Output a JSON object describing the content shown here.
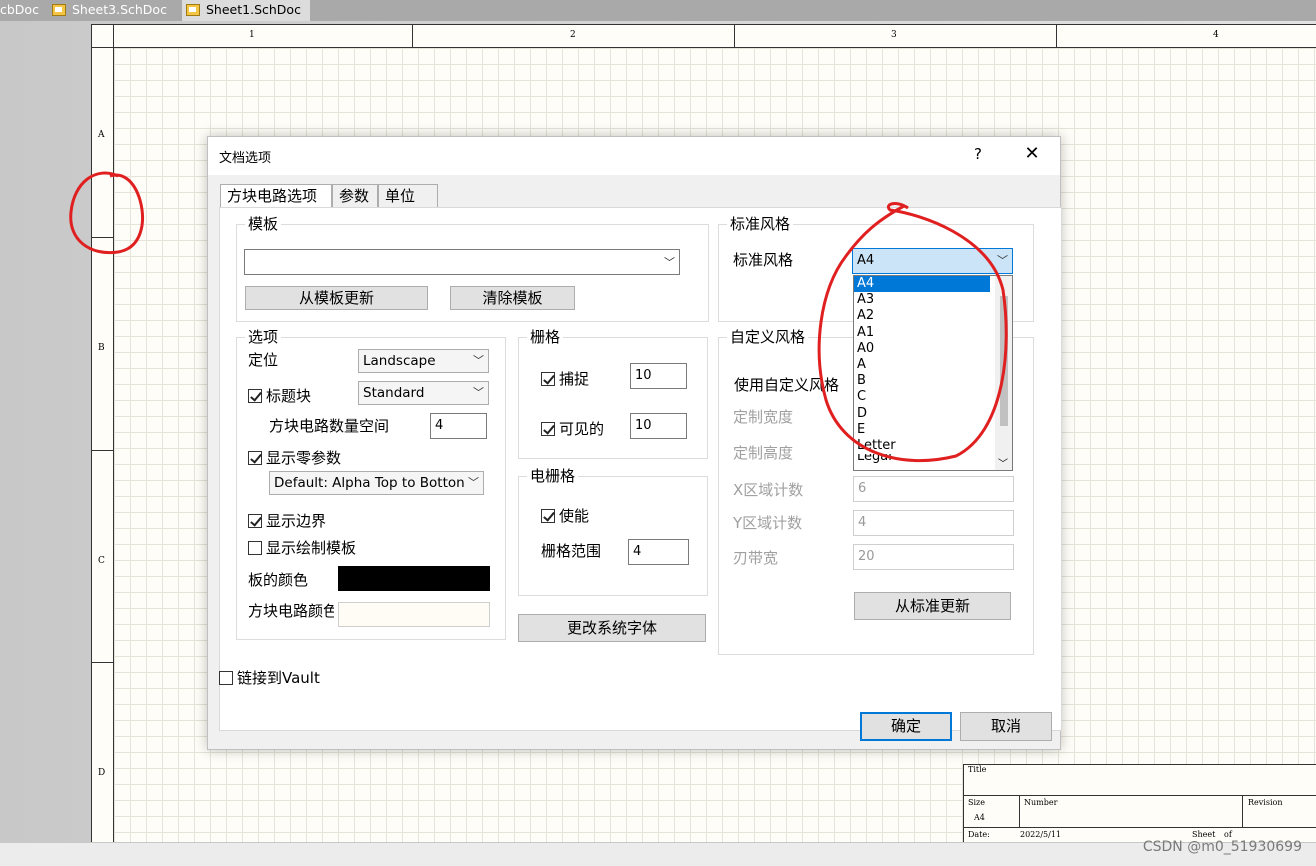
{
  "doc_tabs": [
    {
      "label": "cbDoc"
    },
    {
      "label": "Sheet3.SchDoc"
    },
    {
      "label": "Sheet1.SchDoc"
    }
  ],
  "sheet": {
    "col_labels": [
      "1",
      "2",
      "3",
      "4"
    ],
    "row_labels": [
      "A",
      "B",
      "C",
      "D"
    ],
    "title_block": {
      "title": "Title",
      "size": "Size",
      "size_value": "A4",
      "number": "Number",
      "revision": "Revision",
      "date": "Date:",
      "date_value": "2022/5/11",
      "sheet": "Sheet",
      "of": "of"
    }
  },
  "dialog": {
    "title": "文档选项",
    "help": "?",
    "close": "✕",
    "tabs": [
      {
        "label": "方块电路选项"
      },
      {
        "label": "参数"
      },
      {
        "label": "单位"
      }
    ],
    "template": {
      "group_title": "模板",
      "value": "",
      "update_button": "从模板更新",
      "clear_button": "清除模板"
    },
    "options": {
      "group_title": "选项",
      "orientation_label": "定位",
      "orientation_value": "Landscape",
      "title_block_label": "标题块",
      "title_block_checked": true,
      "title_block_value": "Standard",
      "sheet_number_space_label": "方块电路数量空间",
      "sheet_number_space_value": "4",
      "show_zero_params_label": "显示零参数",
      "show_zero_params_checked": true,
      "sort_value": "Default: Alpha Top to Botton",
      "show_border_label": "显示边界",
      "show_border_checked": true,
      "show_template_graphics_label": "显示绘制模板",
      "show_template_graphics_checked": false,
      "border_color_label": "板的颜色",
      "border_color": "#000000",
      "sheet_color_label": "方块电路颜色",
      "sheet_color": "#fffbf5"
    },
    "grids": {
      "group_title": "栅格",
      "snap_label": "捕捉",
      "snap_checked": true,
      "snap_value": "10",
      "visible_label": "可见的",
      "visible_checked": true,
      "visible_value": "10"
    },
    "electrical_grid": {
      "group_title": "电栅格",
      "enable_label": "使能",
      "enable_checked": true,
      "range_label": "栅格范围",
      "range_value": "4"
    },
    "change_font_button": "更改系统字体",
    "standard_style": {
      "group_title": "标准风格",
      "label": "标准风格",
      "value": "A4",
      "options": [
        "A4",
        "A3",
        "A2",
        "A1",
        "A0",
        "A",
        "B",
        "C",
        "D",
        "E",
        "Letter",
        "Legal"
      ],
      "selected_index": 0
    },
    "custom_style": {
      "group_title": "自定义风格",
      "use_custom_label": "使用自定义风格",
      "width_label": "定制宽度",
      "height_label": "定制高度",
      "x_zones_label": "X区域计数",
      "x_zones_value": "6",
      "y_zones_label": "Y区域计数",
      "y_zones_value": "4",
      "margin_label": "刃带宽",
      "margin_value": "20",
      "update_button": "从标准更新"
    },
    "link_vault_label": "链接到Vault",
    "link_vault_checked": false,
    "ok_button": "确定",
    "cancel_button": "取消"
  },
  "watermark": "CSDN @m0_51930699",
  "colors": {
    "annotation": "#e02020",
    "accent": "#0078d7"
  }
}
